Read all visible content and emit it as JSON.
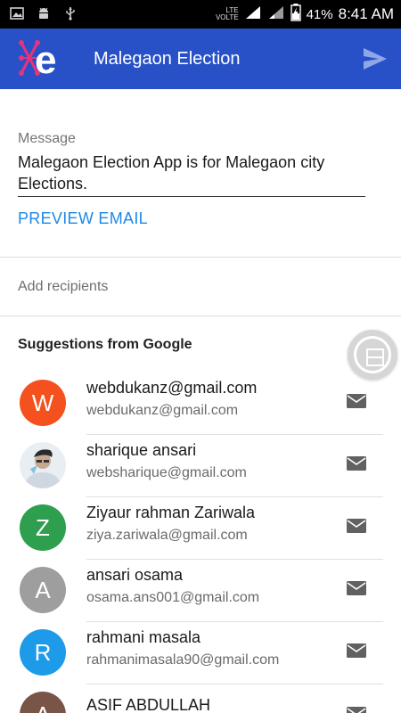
{
  "status_bar": {
    "network_label": "VOLTE",
    "lte_label": "LTE",
    "battery_percent": "41%",
    "time": "8:41 AM",
    "icons": [
      "image-icon",
      "android-icon",
      "usb-icon",
      "signal-icon",
      "signal-icon",
      "battery-charging-icon"
    ]
  },
  "app_bar": {
    "title": "Malegaon Election",
    "color": "#2851c7",
    "send_icon": "send-icon"
  },
  "message": {
    "label": "Message",
    "text": "Malegaon Election App is for Malegaon city Elections.",
    "preview_label": "PREVIEW EMAIL"
  },
  "recipients": {
    "placeholder": "Add recipients"
  },
  "suggestions": {
    "title": "Suggestions from Google",
    "contacts": [
      {
        "initial": "W",
        "name": "webdukanz@gmail.com",
        "email": "webdukanz@gmail.com",
        "color": "#f4511e"
      },
      {
        "initial": "",
        "name": "sharique ansari",
        "email": "websharique@gmail.com",
        "color": "#ffffff",
        "photo": true
      },
      {
        "initial": "Z",
        "name": "Ziyaur rahman Zariwala",
        "email": "ziya.zariwala@gmail.com",
        "color": "#2e9e4f"
      },
      {
        "initial": "A",
        "name": "ansari osama",
        "email": "osama.ans001@gmail.com",
        "color": "#9e9e9e"
      },
      {
        "initial": "R",
        "name": "rahmani masala",
        "email": "rahmanimasala90@gmail.com",
        "color": "#1e9be8"
      },
      {
        "initial": "A",
        "name": "ASIF ABDULLAH",
        "email": "",
        "color": "#795548"
      }
    ]
  }
}
